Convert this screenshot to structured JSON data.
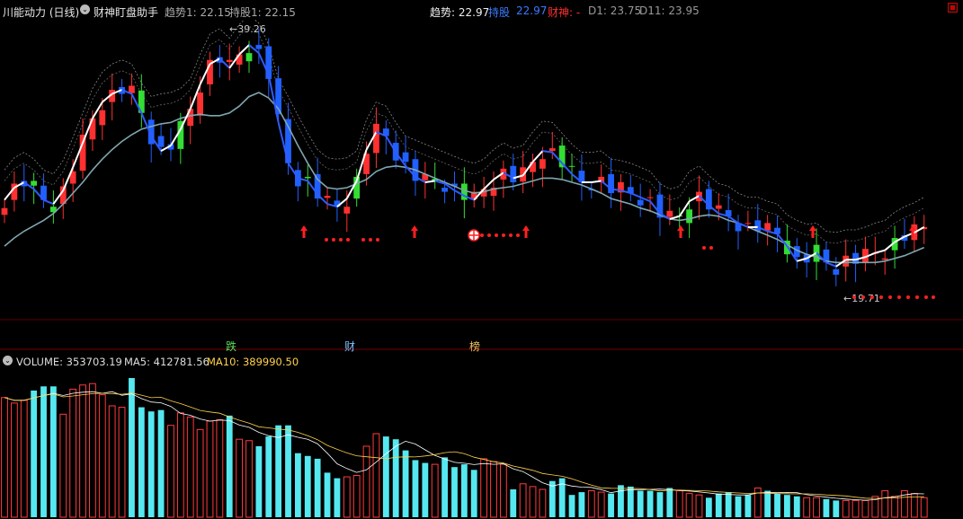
{
  "header": {
    "title": "川能动力 (日线)",
    "indicator_name": "财神盯盘助手",
    "trend_label": "趋势1: 22.15",
    "hold_label": "持股1: 22.15",
    "trend_value_label": "趋势: 22.97",
    "hold_value_label": "持股",
    "hold_value": "22.97",
    "god_label": "财神: -",
    "d1_label": "D1: 23.75",
    "d11_label": "D11: 23.95"
  },
  "annotations": {
    "high_label": "39.26",
    "low_label": "19.71"
  },
  "signals": {
    "s1": "跌",
    "s2": "财",
    "s3": "榜"
  },
  "volume": {
    "volume_label": "VOLUME: 353703.19",
    "ma5_label": "MA5: 412781.56",
    "ma10_label": "MA10: 389990.50"
  },
  "colors": {
    "up": "#ff3030",
    "down": "#2060ff",
    "green": "#33dd33",
    "ma_white": "#ffffff",
    "ma_long": "#7fa6b0",
    "vol_up": "#ff3b3b",
    "vol_down": "#55e8f0",
    "ma10_vol": "#ffd24a"
  },
  "chart_data": {
    "type": "candlestick",
    "price_high": 39.26,
    "price_low": 19.71,
    "trend_line": [
      26.8,
      27.7,
      28.1,
      27.6,
      26.8,
      26.5,
      27.5,
      29.2,
      31.0,
      32.8,
      34.0,
      34.6,
      34.9,
      34.6,
      33.2,
      31.5,
      30.4,
      30.8,
      32.0,
      33.5,
      35.3,
      36.8,
      37.2,
      36.5,
      37.5,
      38.2,
      37.6,
      36.0,
      32.5,
      29.5,
      28.4,
      28.2,
      27.2,
      26.5,
      26.3,
      26.9,
      28.2,
      30.5,
      31.8,
      31.5,
      30.3,
      29.3,
      28.5,
      28.1,
      28.2,
      28.0,
      27.5,
      27.1,
      26.8,
      27.6,
      28.3,
      28.8,
      28.4,
      28.6,
      29.6,
      30.4,
      30.3,
      29.5,
      28.7,
      28.1,
      28.1,
      28.2,
      27.6,
      27.5,
      27.3,
      27.0,
      26.7,
      25.8,
      25.4,
      25.6,
      26.7,
      27.1,
      26.4,
      25.8,
      25.6,
      25.1,
      24.8,
      24.8,
      24.5,
      24.3,
      23.4,
      22.3,
      22.5,
      22.9,
      22.2,
      21.9,
      22.4,
      22.4,
      22.6,
      22.9,
      23.1,
      23.7,
      24.1,
      24.4,
      24.8
    ],
    "ma_long_line": [
      23.4,
      24.0,
      24.5,
      24.9,
      25.3,
      25.8,
      26.5,
      27.3,
      28.1,
      29.0,
      29.8,
      30.5,
      31.1,
      31.6,
      32.0,
      32.2,
      32.4,
      32.5,
      32.8,
      33.0,
      33.1,
      33.0,
      33.0,
      33.2,
      33.7,
      34.4,
      34.7,
      34.3,
      33.5,
      32.2,
      30.8,
      29.5,
      28.3,
      27.7,
      27.6,
      27.7,
      28.0,
      28.3,
      28.9,
      29.2,
      29.3,
      29.2,
      29.0,
      28.7,
      28.4,
      28.1,
      27.8,
      27.5,
      27.3,
      27.4,
      27.6,
      27.7,
      27.8,
      28.0,
      28.2,
      28.4,
      28.4,
      28.3,
      28.1,
      27.9,
      27.6,
      27.3,
      26.9,
      26.7,
      26.5,
      26.2,
      26.0,
      25.7,
      25.4,
      25.3,
      25.4,
      25.6,
      25.7,
      25.6,
      25.3,
      25.1,
      24.8,
      24.5,
      24.2,
      23.9,
      23.5,
      23.1,
      22.8,
      22.6,
      22.3,
      22.2,
      22.2,
      22.2,
      22.2,
      22.2,
      22.3,
      22.5,
      22.7,
      23.0,
      23.3
    ],
    "volume": [
      86,
      82,
      84,
      91,
      94,
      94,
      74,
      92,
      95,
      96,
      88,
      80,
      79,
      100,
      79,
      76,
      77,
      66,
      75,
      72,
      63,
      69,
      70,
      73,
      56,
      55,
      51,
      58,
      66,
      66,
      46,
      44,
      42,
      32,
      28,
      29,
      30,
      51,
      60,
      58,
      56,
      48,
      41,
      39,
      38,
      43,
      36,
      38,
      34,
      42,
      40,
      38,
      20,
      24,
      22,
      20,
      26,
      28,
      16,
      18,
      19,
      18,
      17,
      23,
      22,
      19,
      19,
      18,
      21,
      19,
      17,
      16,
      14,
      17,
      18,
      15,
      16,
      21,
      19,
      17,
      16,
      15,
      14,
      14,
      13,
      12,
      12,
      12,
      12,
      15,
      19,
      15,
      19,
      17,
      14
    ]
  }
}
